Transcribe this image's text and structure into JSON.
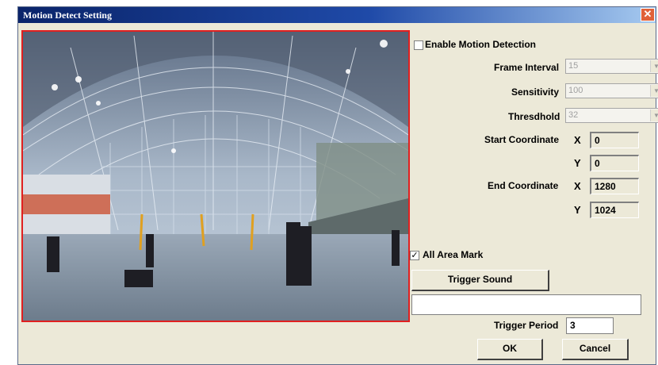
{
  "window": {
    "title": "Motion Detect Setting",
    "close_glyph": "✕"
  },
  "enable_motion": {
    "label": "Enable Motion Detection",
    "checked": false
  },
  "frame_interval": {
    "label": "Frame Interval",
    "value": "15"
  },
  "sensitivity": {
    "label": "Sensitivity",
    "value": "100"
  },
  "threshold": {
    "label": "Thresdhold",
    "value": "32"
  },
  "start_coordinate": {
    "label": "Start Coordinate",
    "x_label": "X",
    "y_label": "Y",
    "x": "0",
    "y": "0"
  },
  "end_coordinate": {
    "label": "End Coordinate",
    "x_label": "X",
    "y_label": "Y",
    "x": "1280",
    "y": "1024"
  },
  "all_area_mark": {
    "label": "All Area Mark",
    "checked": true,
    "check_glyph": "✓"
  },
  "trigger_sound": {
    "label": "Trigger Sound",
    "path": ""
  },
  "trigger_period": {
    "label": "Trigger Period",
    "value": "3"
  },
  "buttons": {
    "ok": "OK",
    "cancel": "Cancel"
  },
  "colors": {
    "title_bar": "#0a246a",
    "dialog_bg": "#ece9d8",
    "preview_border": "#e02020",
    "close_button": "#e0613a"
  }
}
